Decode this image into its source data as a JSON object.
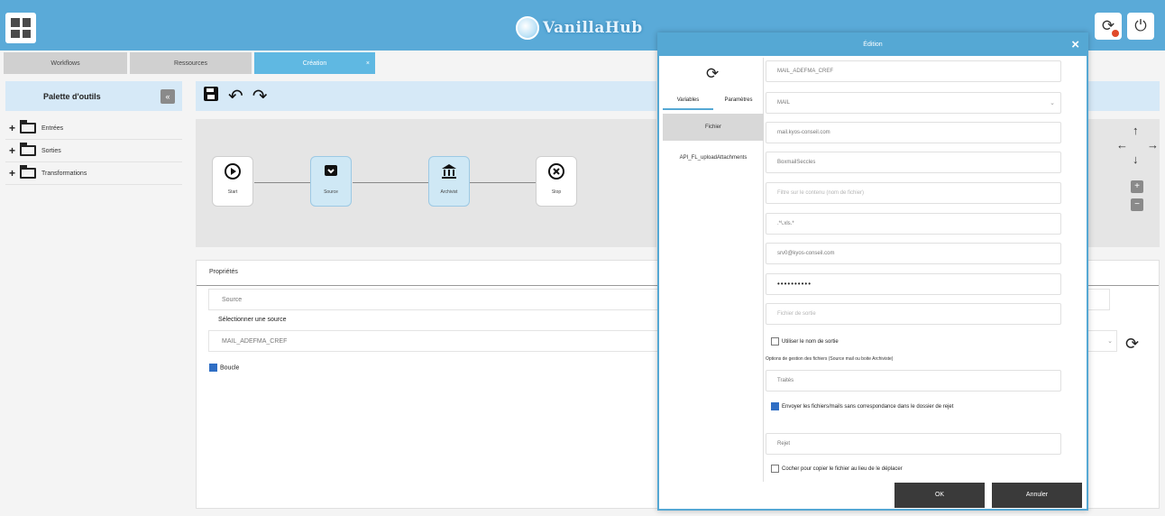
{
  "header": {
    "brand": "VanillaHub",
    "icons": [
      "grid-menu-icon",
      "refresh-alert-icon",
      "power-icon"
    ]
  },
  "tabs": [
    {
      "label": "Workflows"
    },
    {
      "label": "Ressources"
    },
    {
      "label": "Création"
    }
  ],
  "sidebar": {
    "title": "Palette d'outils",
    "items": [
      {
        "label": "Entrées"
      },
      {
        "label": "Sorties"
      },
      {
        "label": "Transformations"
      }
    ]
  },
  "workflow": {
    "nodes": [
      {
        "label": "Start",
        "icon": "play-icon"
      },
      {
        "label": "Source",
        "icon": "inbox-icon"
      },
      {
        "label": "Archivist",
        "icon": "bank-icon"
      },
      {
        "label": "Stop",
        "icon": "stop-icon"
      }
    ]
  },
  "properties": {
    "title": "Propriétés",
    "name_value": "Source",
    "select_label": "Sélectionner une source",
    "select_value": "MAIL_ADEFMA_CREF",
    "loop_label": "Boucle",
    "loop_checked": true
  },
  "dialog": {
    "title": "Édition",
    "left_tabs": [
      {
        "label": "Variables"
      },
      {
        "label": "Paramètres"
      }
    ],
    "left_items": [
      {
        "label": "Fichier"
      },
      {
        "label": "API_FL_uploadAttachments"
      }
    ],
    "fields": [
      {
        "value": "MAIL_ADEFMA_CREF",
        "placeholder": false
      },
      {
        "value": "MAIL",
        "placeholder": false,
        "dropdown": true
      },
      {
        "value": "mail.kyos-conseil.com",
        "placeholder": false
      },
      {
        "value": "BoxmailSeccles",
        "placeholder": false
      },
      {
        "value": "Filtre sur le contenu (nom de fichier)",
        "placeholder": true
      },
      {
        "value": ".*\\.xls.*",
        "placeholder": false
      },
      {
        "value": "srv0@kyos-conseil.com",
        "placeholder": false
      },
      {
        "value": "••••••••••",
        "placeholder": false,
        "password": true
      },
      {
        "value": "Fichier de sortie",
        "placeholder": true
      }
    ],
    "use_output_name_label": "Utiliser le nom de sortie",
    "options_note": "Options de gestion des fichiers (Source mail ou boite Archiviste)",
    "treated_value": "Traités",
    "move_unmatched_label": "Envoyer les fichiers/mails sans correspondance dans le dossier de rejet",
    "reject_value": "Rejet",
    "copy_instead_label": "Cocher pour copier le fichier au lieu de le déplacer",
    "ok_label": "OK",
    "cancel_label": "Annuler"
  }
}
